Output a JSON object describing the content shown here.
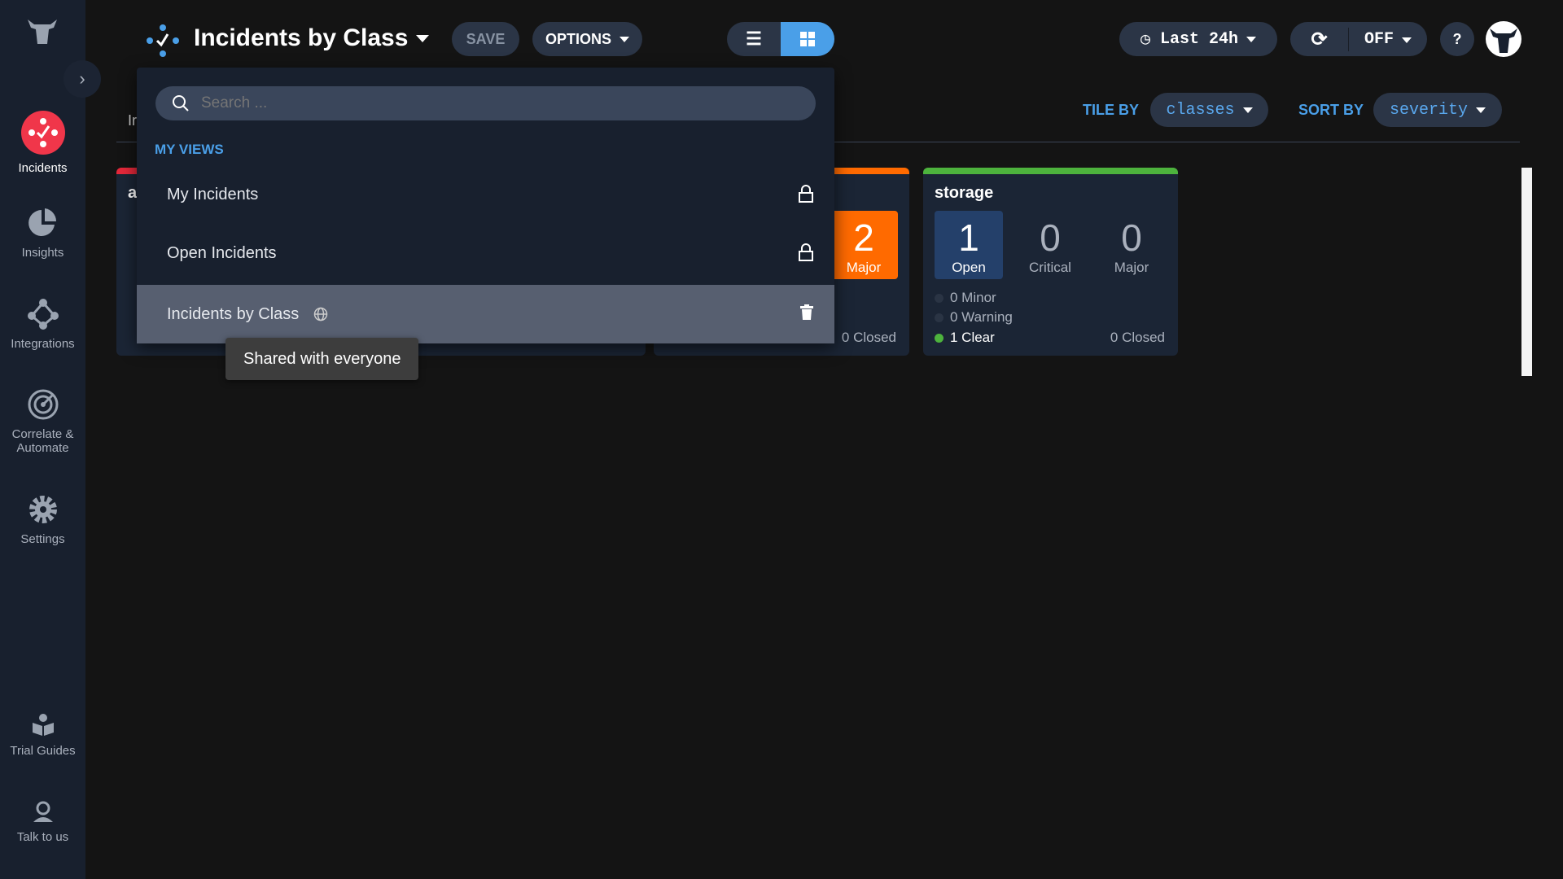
{
  "sidebar": {
    "items": [
      {
        "label": "Incidents",
        "icon": "incidents-icon",
        "active": true
      },
      {
        "label": "Insights",
        "icon": "pie-chart-icon"
      },
      {
        "label": "Integrations",
        "icon": "integrations-icon"
      },
      {
        "label": "Correlate &",
        "label2": "Automate",
        "icon": "radar-icon"
      },
      {
        "label": "Settings",
        "icon": "gear-icon"
      },
      {
        "label": "Trial Guides",
        "icon": "book-icon"
      },
      {
        "label": "Talk to us",
        "icon": "support-agent-icon"
      }
    ]
  },
  "header": {
    "title": "Incidents by Class",
    "save_label": "SAVE",
    "options_label": "OPTIONS",
    "time_range": "Last 24h",
    "refresh_value": "OFF",
    "help_label": "?"
  },
  "toolbar": {
    "tab_partial": "Ir",
    "tile_by_label": "TILE BY",
    "tile_by_value": "classes",
    "sort_by_label": "SORT BY",
    "sort_by_value": "severity"
  },
  "dropdown": {
    "search_placeholder": "Search ...",
    "section_label": "MY VIEWS",
    "items": [
      {
        "label": "My Incidents",
        "icon": "lock-icon"
      },
      {
        "label": "Open Incidents",
        "icon": "lock-icon"
      },
      {
        "label": "Incidents by Class",
        "icon": "globe-icon",
        "action": "trash-icon",
        "highlighted": true
      }
    ],
    "tooltip": "Shared with everyone"
  },
  "tiles": [
    {
      "name_partial": "a",
      "color": "#e5283a"
    },
    {
      "color": "#ff6a00",
      "major_count": "2",
      "major_label": "Major",
      "closed": "0 Closed"
    },
    {
      "name": "storage",
      "color": "#4db33d",
      "open_count": "1",
      "open_label": "Open",
      "critical_count": "0",
      "critical_label": "Critical",
      "major_count": "0",
      "major_label": "Major",
      "minor": "0 Minor",
      "warning": "0 Warning",
      "clear": "1 Clear",
      "closed": "0 Closed"
    }
  ],
  "colors": {
    "accent": "#4a9fe8",
    "brand_red": "#f0364a",
    "major": "#ff6a00",
    "clear": "#4db33d"
  }
}
